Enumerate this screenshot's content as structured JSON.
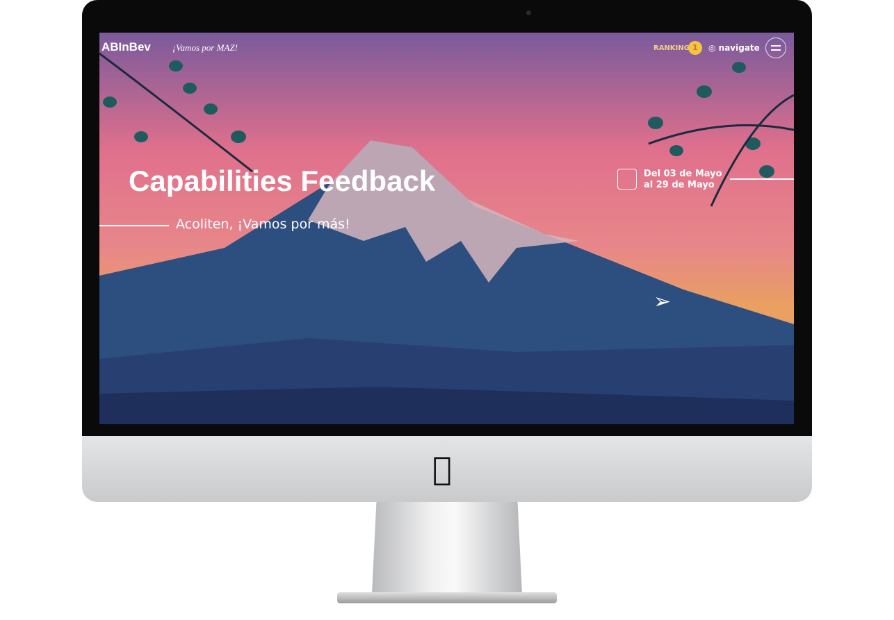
{
  "header": {
    "logo": "ABInBev",
    "slogan": "¡Vamos por MAZ!",
    "ranking_label": "RANKING",
    "ranking_position": "1",
    "navigate_label": "navigate",
    "menu_icon": "hamburger-icon"
  },
  "hero": {
    "title": "Capabilities Feedback",
    "subtitle": "Acoliten, ¡Vamos por más!",
    "date_line1": "Del 03 de Mayo",
    "date_line2": "al 29 de Mayo",
    "calendar_icon": "calendar-icon",
    "scroll_icon": "paper-plane-arrow-icon"
  },
  "colors": {
    "sky_top": "#7a5a9c",
    "sky_mid": "#e6738a",
    "sky_bottom": "#e9a060",
    "mountain": "#2c4f80",
    "snow": "#d6b5bd",
    "ranking": "#f3d08a"
  }
}
